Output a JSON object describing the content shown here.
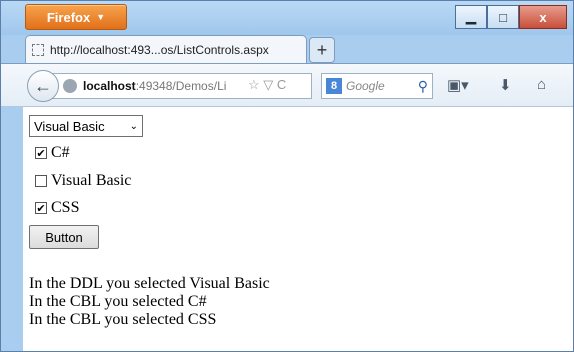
{
  "browser": {
    "app_button": "Firefox",
    "app_button_arrow": "▼",
    "window_controls": {
      "minimize": "▁",
      "maximize": "□",
      "close": "x"
    },
    "tab_title": "http://localhost:493...os/ListControls.aspx",
    "new_tab": "+",
    "back": "←",
    "url_host": "localhost",
    "url_rest": ":49348/Demos/Li",
    "url_icons": "☆ ▽ C",
    "search_engine_icon": "8",
    "search_placeholder": "Google",
    "search_icon": "⚲",
    "toolbar_icons": {
      "bookmarks": "▣▾",
      "downloads": "⬇",
      "home": "⌂"
    }
  },
  "page": {
    "ddl": {
      "selected": "Visual Basic",
      "chevron": "⌄"
    },
    "checkboxes": [
      {
        "label": "C#",
        "checked": true,
        "mark": "✔"
      },
      {
        "label": "Visual Basic",
        "checked": false,
        "mark": ""
      },
      {
        "label": "CSS",
        "checked": true,
        "mark": "✔"
      }
    ],
    "button_label": "Button",
    "messages": [
      "In the DDL you selected Visual Basic",
      "In the CBL you selected C#",
      "In the CBL you selected CSS"
    ]
  }
}
